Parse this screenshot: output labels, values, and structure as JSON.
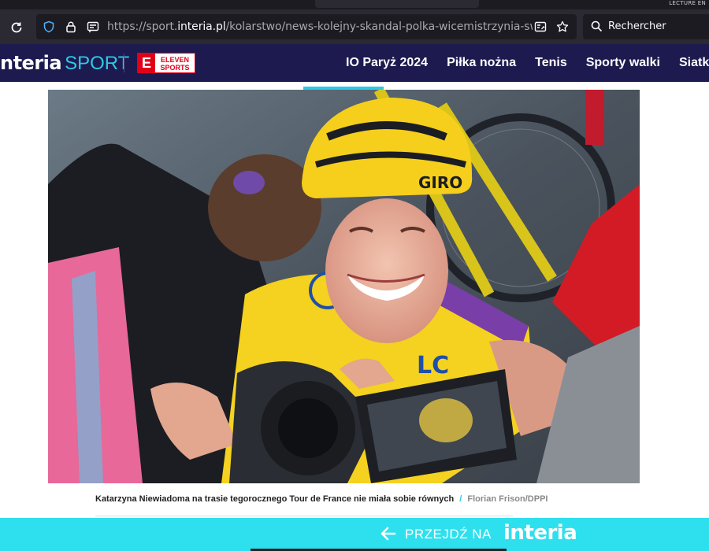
{
  "browser": {
    "corner_label": "LECTURE EN",
    "url_prefix": "https://sport.",
    "url_domain": "interia.pl",
    "url_path": "/kolarstwo/news-kolejny-skandal-polka-wicemistrzynia-swiata-wy",
    "search_placeholder": "Rechercher"
  },
  "site": {
    "logo_text": "nteria",
    "logo_suffix": "SPORT",
    "partner_letter": "E",
    "partner_line1": "ELEVEN",
    "partner_line2": "SPORTS",
    "nav": [
      "IO Paryż 2024",
      "Piłka nożna",
      "Tenis",
      "Sporty walki",
      "Siatkówka"
    ]
  },
  "article": {
    "caption": "Katarzyna Niewiadoma na trasie tegorocznego Tour de France nie miała sobie równych",
    "separator": "/",
    "credit": "Florian Frison/DPPI"
  },
  "banner": {
    "label": "PRZEJDŹ NA",
    "brand": "interia"
  },
  "colors": {
    "header_bg": "#1d1a4f",
    "accent_cyan": "#2ec9e6",
    "banner_bg": "#2ee0ee",
    "partner_red": "#e1001a"
  }
}
